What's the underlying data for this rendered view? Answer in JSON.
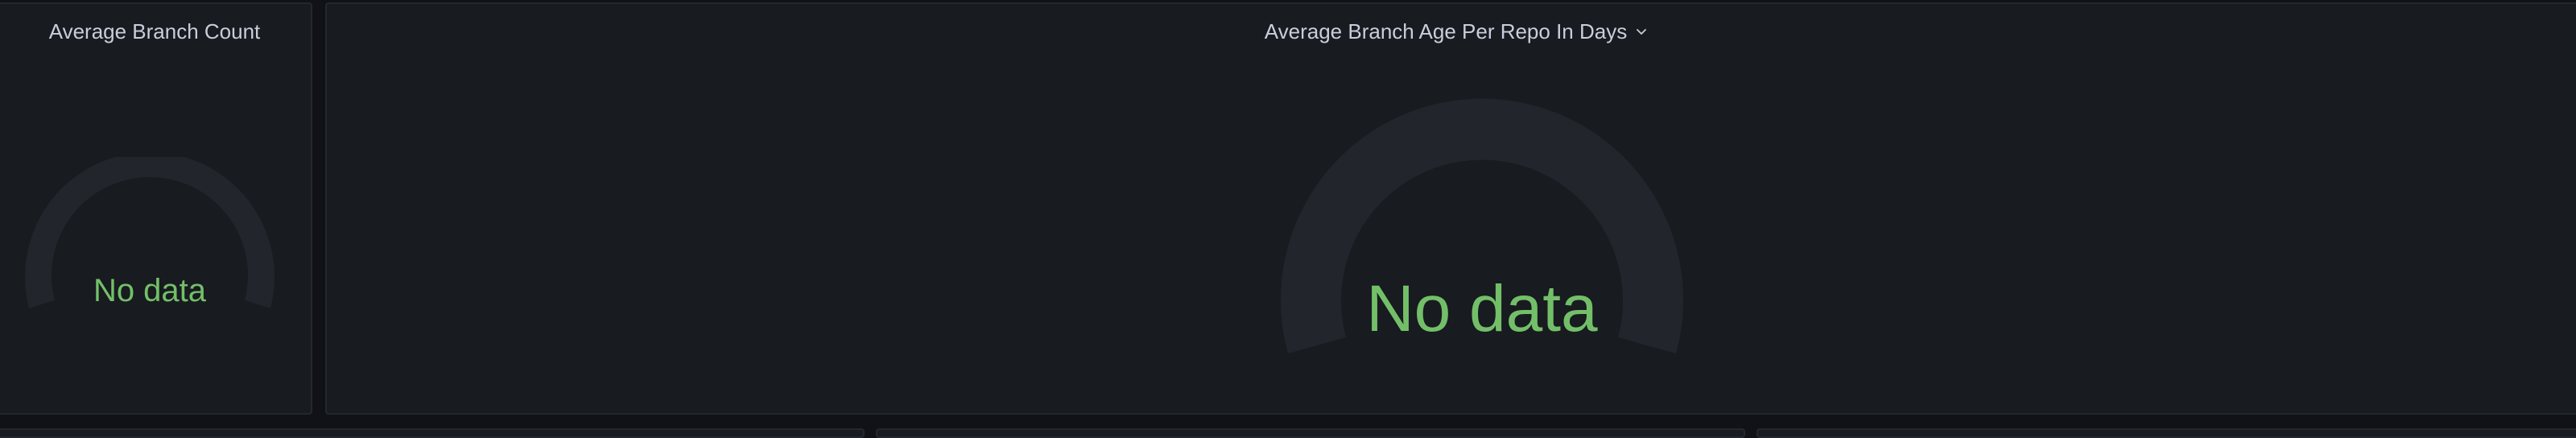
{
  "panels": {
    "left": {
      "title": "Average Branch Count",
      "value_text": "No data"
    },
    "right": {
      "title": "Average Branch Age Per Repo In Days",
      "value_text": "No data",
      "menu_icon": "chevron-down-icon"
    }
  },
  "colors": {
    "background": "#111217",
    "panel_bg": "#181b1f",
    "panel_border": "#24272d",
    "gauge_track": "#22252b",
    "title_text": "#ccccdc",
    "no_data_green": "#73bf69"
  }
}
